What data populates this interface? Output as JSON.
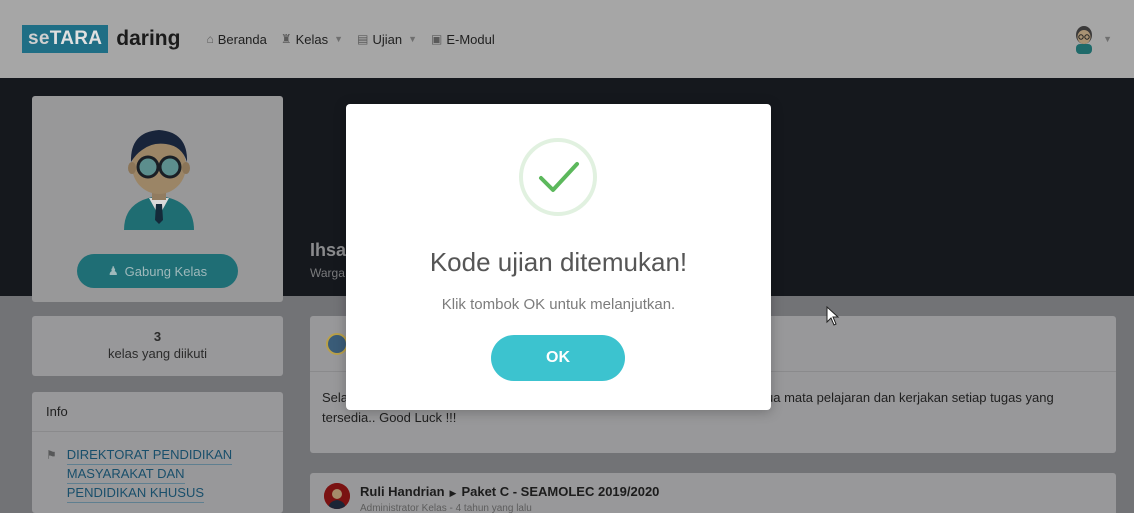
{
  "navbar": {
    "brand_prefix_se": "se",
    "brand_prefix_tara": "TARA",
    "brand_suffix": "daring",
    "items": [
      {
        "label": "Beranda",
        "icon": "home-icon",
        "has_caret": false
      },
      {
        "label": "Kelas",
        "icon": "users-icon",
        "has_caret": true
      },
      {
        "label": "Ujian",
        "icon": "clipboard-icon",
        "has_caret": true
      },
      {
        "label": "E-Modul",
        "icon": "book-icon",
        "has_caret": false
      }
    ]
  },
  "hero": {
    "name": "Ihsa",
    "subtitle": "Warga"
  },
  "profile": {
    "join_button_label": "Gabung Kelas"
  },
  "stats": {
    "count": "3",
    "label": "kelas yang diikuti"
  },
  "info": {
    "heading": "Info",
    "links": [
      "DIREKTORAT PENDIDIKAN",
      "MASYARAKAT DAN",
      "PENDIDIKAN KHUSUS"
    ]
  },
  "post1": {
    "text_start": "Sela",
    "text_end": "ua mata pelajaran dan kerjakan setiap tugas yang",
    "text_line2": "tersedia.. Good Luck !!!"
  },
  "post2": {
    "author": "Ruli Handrian",
    "target": "Paket C - SEAMOLEC 2019/2020",
    "meta": "Administrator Kelas - 4 tahun yang lalu"
  },
  "modal": {
    "title": "Kode ujian ditemukan!",
    "text": "Klik tombok OK untuk melanjutkan.",
    "ok_label": "OK",
    "colors": {
      "accent": "#3cc3cf",
      "success": "#5cb85c"
    }
  }
}
